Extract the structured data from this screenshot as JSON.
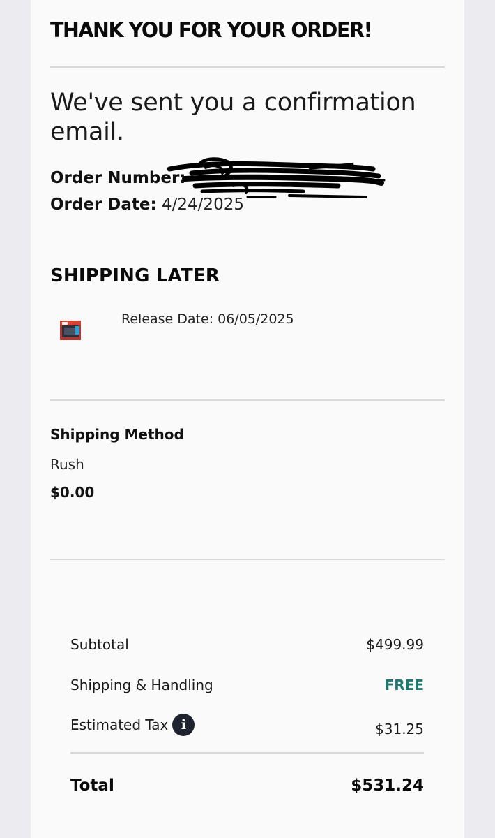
{
  "header": {
    "title": "THANK YOU FOR YOUR ORDER!"
  },
  "confirmation": {
    "message": "We've sent you a confirmation email."
  },
  "order": {
    "number_label": "Order Number:",
    "date_label": "Order Date:",
    "date_value": "4/24/2025"
  },
  "shipping_later": {
    "heading": "SHIPPING LATER",
    "release_date": "Release Date: 06/05/2025"
  },
  "shipping_method": {
    "label": "Shipping Method",
    "method": "Rush",
    "price": "$0.00"
  },
  "summary": {
    "subtotal_label": "Subtotal",
    "subtotal_value": "$499.99",
    "shipping_label": "Shipping & Handling",
    "shipping_value": "FREE",
    "tax_label": "Estimated Tax",
    "tax_info_glyph": "i",
    "tax_value": "$31.25",
    "total_label": "Total",
    "total_value": "$531.24"
  },
  "colors": {
    "free_text": "#1f7a6d",
    "info_icon_bg": "#1f2330"
  }
}
